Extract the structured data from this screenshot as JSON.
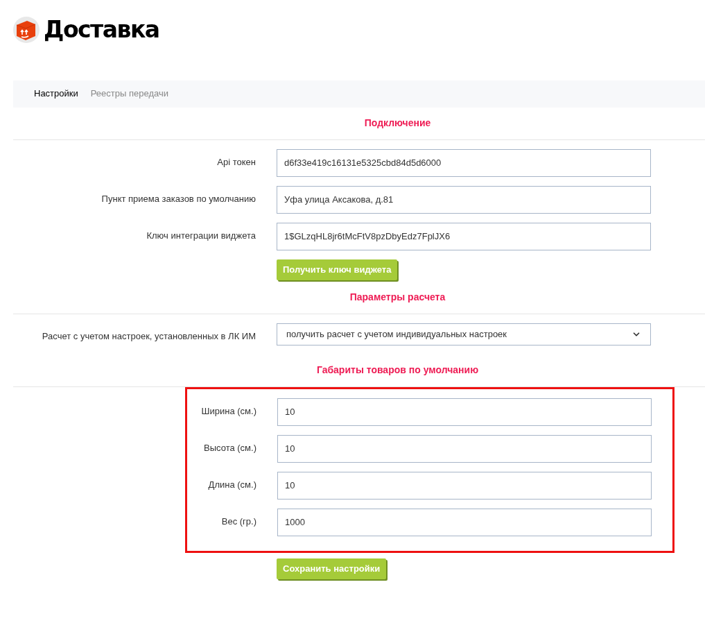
{
  "header": {
    "title": "Доставка"
  },
  "tabs": [
    {
      "label": "Настройки",
      "selected": true
    },
    {
      "label": "Реестры передачи",
      "selected": false
    }
  ],
  "sections": [
    {
      "title": "Подключение",
      "highlighted": false,
      "rows": [
        {
          "kind": "text",
          "label": "Api токен",
          "value": "d6f33e419c16131e5325cbd84d5d6000"
        },
        {
          "kind": "text",
          "label": "Пункт приема заказов по умолчанию",
          "value": "Уфа улица Аксакова, д.81"
        },
        {
          "kind": "text",
          "label": "Ключ интеграции виджета",
          "value": "1$GLzqHL8jr6tMcFtV8pzDbyEdz7FplJX6"
        }
      ],
      "button": "Получить ключ виджета"
    },
    {
      "title": "Параметры расчета",
      "highlighted": false,
      "rows": [
        {
          "kind": "select",
          "label": "Расчет с учетом настроек, установленных в ЛК ИМ",
          "value": "получить расчет с учетом индивидуальных настроек"
        }
      ]
    },
    {
      "title": "Габариты товаров по умолчанию",
      "highlighted": true,
      "rows": [
        {
          "kind": "text",
          "label": "Ширина (см.)",
          "value": "10"
        },
        {
          "kind": "text",
          "label": "Высота (см.)",
          "value": "10"
        },
        {
          "kind": "text",
          "label": "Длина (см.)",
          "value": "10"
        },
        {
          "kind": "text",
          "label": "Вес (гр.)",
          "value": "1000"
        }
      ],
      "button": "Сохранить настройки"
    }
  ]
}
